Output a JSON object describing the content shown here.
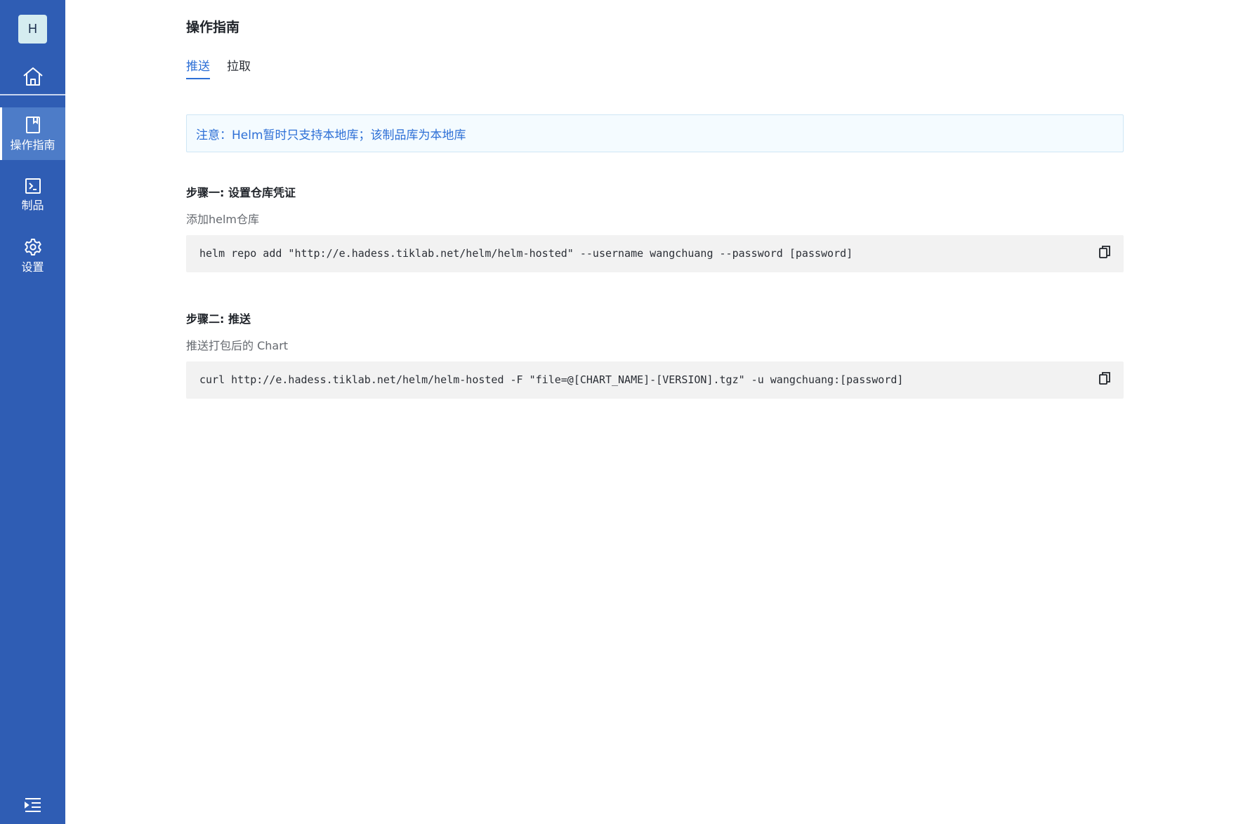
{
  "app": {
    "logo_letter": "H"
  },
  "sidebar": {
    "home_icon": "home-icon",
    "items": [
      {
        "label": "操作指南",
        "icon": "book-icon",
        "active": true
      },
      {
        "label": "制品",
        "icon": "terminal-icon",
        "active": false
      },
      {
        "label": "设置",
        "icon": "gear-icon",
        "active": false
      }
    ],
    "collapse_icon": "menu-indent-icon"
  },
  "colors": {
    "sidebar_bg": "#2f5db4",
    "sidebar_active_bg": "#4d7cc8",
    "accent": "#2d6fd6",
    "notice_bg": "#f4fbff",
    "code_bg": "#f2f2f2"
  },
  "main": {
    "title": "操作指南",
    "tabs": [
      {
        "label": "推送",
        "active": true
      },
      {
        "label": "拉取",
        "active": false
      }
    ],
    "notice": "注意：Helm暂时只支持本地库；该制品库为本地库",
    "steps": [
      {
        "title": "步骤一: 设置仓库凭证",
        "description": "添加helm仓库",
        "command": "helm repo add \"http://e.hadess.tiklab.net/helm/helm-hosted\" --username wangchuang --password [password]",
        "copy_icon": "copy-icon"
      },
      {
        "title": "步骤二: 推送",
        "description": "推送打包后的 Chart",
        "command": "curl http://e.hadess.tiklab.net/helm/helm-hosted -F \"file=@[CHART_NAME]-[VERSION].tgz\" -u wangchuang:[password]",
        "copy_icon": "copy-icon"
      }
    ]
  }
}
